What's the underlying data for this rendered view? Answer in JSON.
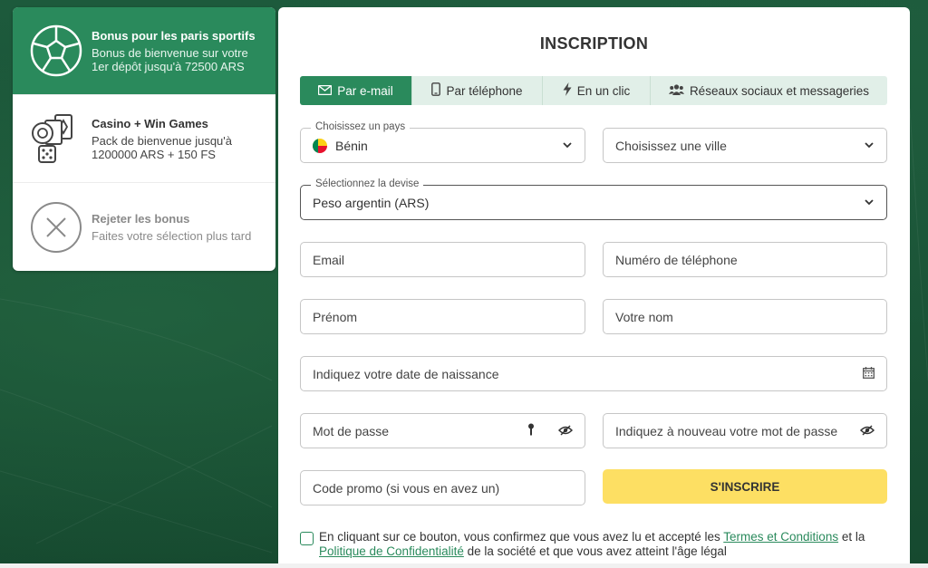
{
  "bonuses": [
    {
      "title": "Bonus pour les paris sportifs",
      "desc": "Bonus de bienvenue sur votre 1er dépôt jusqu'à 72500 ARS",
      "icon": "soccer-ball-icon"
    },
    {
      "title": "Casino + Win Games",
      "desc": "Pack de bienvenue jusqu'à 1200000 ARS + 150 FS",
      "icon": "casino-cards-dice-icon"
    },
    {
      "title": "Rejeter les bonus",
      "desc": "Faites votre sélection plus tard",
      "icon": "close-circle-icon"
    }
  ],
  "form": {
    "title": "INSCRIPTION",
    "tabs": [
      {
        "label": "Par e-mail",
        "icon": "envelope-icon",
        "active": true
      },
      {
        "label": "Par téléphone",
        "icon": "phone-icon"
      },
      {
        "label": "En un clic",
        "icon": "lightning-icon"
      },
      {
        "label": "Réseaux sociaux et messageries",
        "icon": "users-icon"
      }
    ],
    "country": {
      "label": "Choisissez un pays",
      "value": "Bénin"
    },
    "city": {
      "placeholder": "Choisissez une ville"
    },
    "currency": {
      "label": "Sélectionnez la devise",
      "value": "Peso argentin (ARS)"
    },
    "email": {
      "placeholder": "Email"
    },
    "phone": {
      "placeholder": "Numéro de téléphone"
    },
    "first_name": {
      "placeholder": "Prénom"
    },
    "last_name": {
      "placeholder": "Votre nom"
    },
    "birthdate": {
      "placeholder": "Indiquez votre date de naissance"
    },
    "password": {
      "placeholder": "Mot de passe"
    },
    "password_confirm": {
      "placeholder": "Indiquez à nouveau votre mot de passe"
    },
    "promo": {
      "placeholder": "Code promo (si vous en avez un)"
    },
    "submit_label": "S'INSCRIRE",
    "terms": {
      "text_before": "En cliquant sur ce bouton, vous confirmez que vous avez lu et accepté les ",
      "link_terms": "Termes et Conditions",
      "text_middle": " et la ",
      "link_privacy": "Politique de Confidentialité",
      "text_after": " de la société et que vous avez atteint l'âge légal"
    }
  },
  "colors": {
    "accent": "#2a8a5c",
    "submit": "#fddf63",
    "background": "#1f5b3d"
  }
}
